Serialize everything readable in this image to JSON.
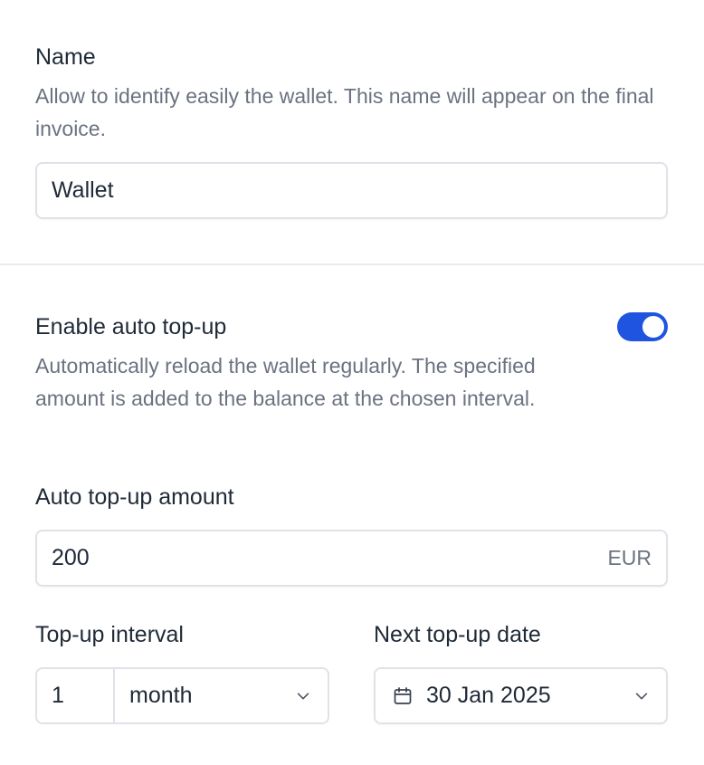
{
  "name_section": {
    "label": "Name",
    "help": "Allow to identify easily the wallet. This name will appear on the final invoice.",
    "input_value": "Wallet"
  },
  "auto_topup": {
    "label": "Enable auto top-up",
    "help": "Automatically reload the wallet regularly. The specified amount is added to the balance at the chosen interval.",
    "enabled": true,
    "accent": "#1f54e0"
  },
  "amount": {
    "label": "Auto top-up amount",
    "value": "200",
    "currency": "EUR"
  },
  "interval": {
    "label": "Top-up interval",
    "count": "1",
    "unit": "month",
    "icon": "chevron-down-icon"
  },
  "next_date": {
    "label": "Next top-up date",
    "value": "30 Jan 2025",
    "icons": [
      "calendar-icon",
      "chevron-down-icon"
    ]
  }
}
